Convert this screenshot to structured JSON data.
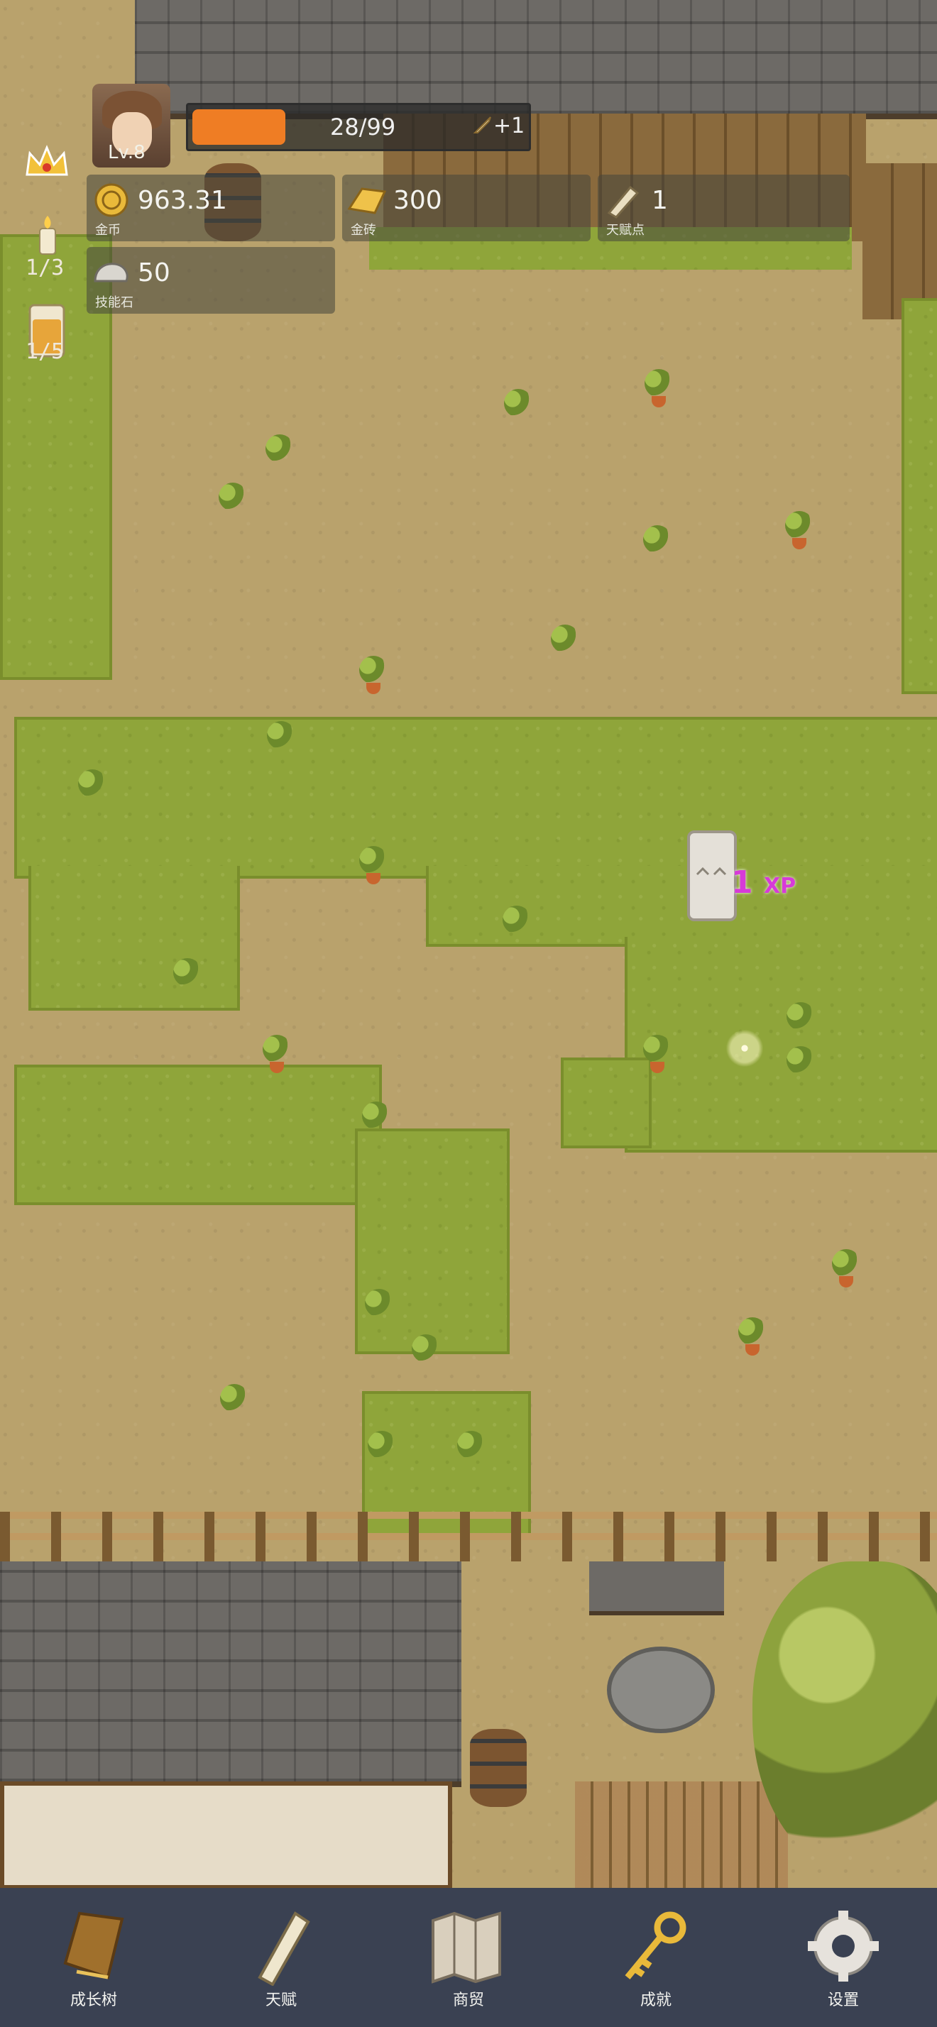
{
  "player": {
    "level_label": "Lv.8",
    "xp_text": "28/99",
    "xp_progress": 0.28,
    "bonus_text": "+1"
  },
  "resources": {
    "coins": {
      "value": "963.31",
      "caption": "金币",
      "icon": "gold-coin-icon"
    },
    "gold_bricks": {
      "value": "300",
      "caption": "金砖",
      "icon": "gold-brick-icon"
    },
    "talent_points": {
      "value": "1",
      "caption": "天赋点",
      "icon": "scroll-icon"
    },
    "skill_stones": {
      "value": "50",
      "caption": "技能石",
      "icon": "stone-icon"
    }
  },
  "side": {
    "candle_count": "1/3",
    "drink_count": "1/5"
  },
  "floating": {
    "xp_number": "1",
    "xp_unit": "XP"
  },
  "nav": [
    {
      "label": "成长树",
      "icon": "book-icon"
    },
    {
      "label": "天赋",
      "icon": "scroll-icon"
    },
    {
      "label": "商贸",
      "icon": "map-icon"
    },
    {
      "label": "成就",
      "icon": "key-icon"
    },
    {
      "label": "设置",
      "icon": "gear-icon"
    }
  ],
  "colors": {
    "xp_fill": "#ef7d24",
    "nav_background": "#3a4152",
    "grass": "#8fa53a",
    "dirt": "#b9a26c",
    "xp_popup": "#d73ad8"
  }
}
